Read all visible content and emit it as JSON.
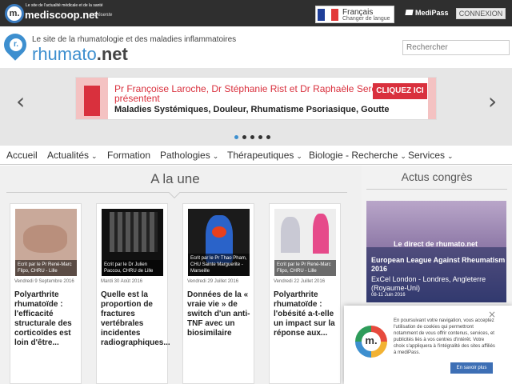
{
  "topbar": {
    "tagline": "Le site de l'actualité médicale et de la santé",
    "site_name": "mediscoop.net",
    "presente": "présente",
    "lang_name": "Français",
    "lang_change": "Changer de langue",
    "medipass": "MediPass",
    "connexion": "CONNEXION"
  },
  "header": {
    "tagline": "Le site de la rhumatologie et des maladies inflammatoires",
    "logo_letter": "r.",
    "name_prefix": "rhumato",
    "name_suffix": ".net",
    "search_placeholder": "Rechercher"
  },
  "carousel": {
    "line1": "Pr Françoise Laroche, Dr Stéphanie Rist et Dr Raphaèle Seror",
    "line2": "présentent",
    "line3": "Maladies Systémiques, Douleur, Rhumatisme Psoriasique, Goutte",
    "cta": "CLIQUEZ ICI",
    "prev_arrow": "‹",
    "next_arrow": "›",
    "slide_count": 5,
    "active_slide": 1
  },
  "nav": {
    "items": [
      {
        "label": "Accueil",
        "has_dropdown": false
      },
      {
        "label": "Actualités",
        "has_dropdown": true
      },
      {
        "label": "Formation",
        "has_dropdown": false
      },
      {
        "label": "Pathologies",
        "has_dropdown": true
      },
      {
        "label": "Thérapeutiques",
        "has_dropdown": true
      },
      {
        "label": "Biologie - Recherche",
        "has_dropdown": true
      },
      {
        "label": "Services",
        "has_dropdown": true
      }
    ],
    "caret": "⌄"
  },
  "une": {
    "title": "A la une",
    "cards": [
      {
        "caption": "Ecrit par le Pr René-Marc Flipo, CHRU - Lille",
        "date": "Vendredi 9 Septembre 2016",
        "title": "Polyarthrite rhumatoïde : l'efficacité structurale des corticoïdes est loin d'être..."
      },
      {
        "caption": "Ecrit par le Dr Julien Paccou, CHRU de Lille",
        "date": "Mardi 30 Août 2016",
        "title": "Quelle est la proportion de fractures vertébrales incidentes radiographiques..."
      },
      {
        "caption": "Ecrit par le Pr Thao Pham, CHU Sainte Marguerite - Marseille",
        "date": "Vendredi 29 Juillet 2016",
        "title": "Données de la « vraie vie » de switch d'un anti-TNF avec un biosimilaire"
      },
      {
        "caption": "Ecrit par le Pr René-Marc Flipo, CHRU - Lille",
        "date": "Vendredi 22 Juillet 2016",
        "title": "Polyarthrite rhumatoïde : l'obésité a-t-elle un impact sur la réponse aux..."
      }
    ]
  },
  "congres": {
    "title": "Actus congrès",
    "direct": "Le direct de rhumato.net",
    "name": "European League Against Rheumatism 2016",
    "place": "ExCel London - Londres, Angleterre (Royaume-Uni)",
    "dates": "08-11 Juin 2016"
  },
  "cookie": {
    "close": "×",
    "logo_letter": "m.",
    "text": "En poursuivant votre navigation, vous acceptez l'utilisation de cookies qui permettront notamment de vous offrir contenus, services, et publicités liés à vos centres d'intérêt. Votre choix s'appliquera à l'intégralité des sites affiliés à mediPass.",
    "button": "En savoir plus"
  },
  "colors": {
    "brand_blue": "#3d8fcf",
    "banner_red": "#d9303d",
    "topbar": "#2f2f2f",
    "cookie_button": "#3d6fb5"
  }
}
